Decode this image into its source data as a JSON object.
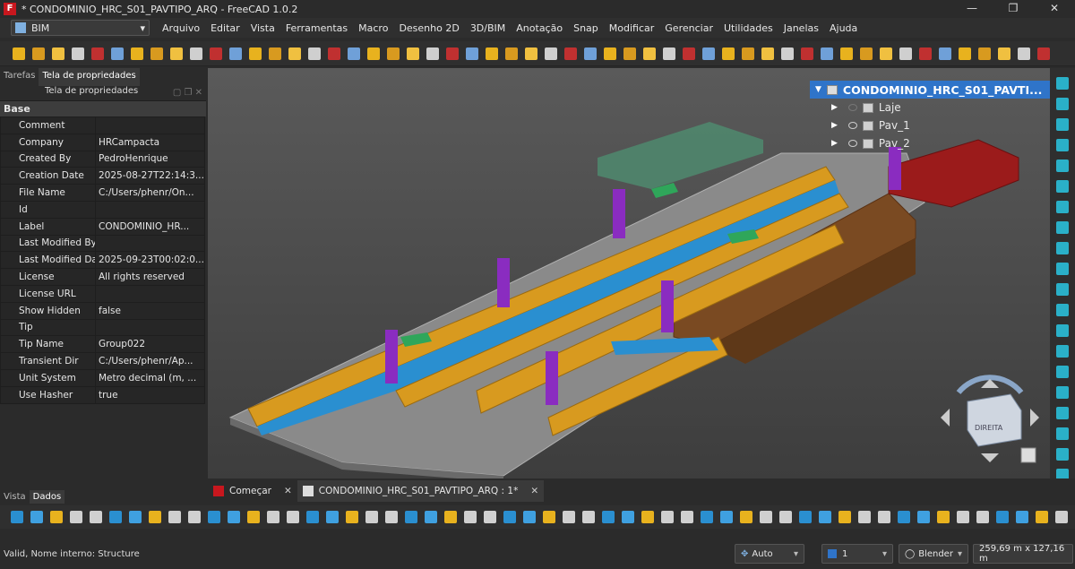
{
  "window": {
    "title": "* CONDOMINIO_HRC_S01_PAVTIPO_ARQ - FreeCAD 1.0.2",
    "logo": "F",
    "controls": [
      "—",
      "❐",
      "✕"
    ]
  },
  "workbench": {
    "selected": "BIM"
  },
  "menu": [
    "Arquivo",
    "Editar",
    "Vista",
    "Ferramentas",
    "Macro",
    "Desenho 2D",
    "3D/BIM",
    "Anotação",
    "Snap",
    "Modificar",
    "Gerenciar",
    "Utilidades",
    "Janelas",
    "Ajuda"
  ],
  "left_panel": {
    "tabs": [
      "Tarefas",
      "Tela de propriedades"
    ],
    "panel_title": "Tela de propriedades",
    "group": "Base",
    "properties": [
      {
        "key": "Comment",
        "value": ""
      },
      {
        "key": "Company",
        "value": "HRCampacta"
      },
      {
        "key": "Created By",
        "value": "PedroHenrique"
      },
      {
        "key": "Creation Date",
        "value": "2025-08-27T22:14:3..."
      },
      {
        "key": "File Name",
        "value": "C:/Users/phenr/On..."
      },
      {
        "key": "Id",
        "value": ""
      },
      {
        "key": "Label",
        "value": "CONDOMINIO_HR..."
      },
      {
        "key": "Last Modified By",
        "value": ""
      },
      {
        "key": "Last Modified Date",
        "value": "2025-09-23T00:02:0..."
      },
      {
        "key": "License",
        "value": "All rights reserved"
      },
      {
        "key": "License URL",
        "value": ""
      },
      {
        "key": "Show Hidden",
        "value": "false"
      },
      {
        "key": "Tip",
        "value": ""
      },
      {
        "key": "Tip Name",
        "value": "Group022"
      },
      {
        "key": "Transient Dir",
        "value": "C:/Users/phenr/Ap..."
      },
      {
        "key": "Unit System",
        "value": "Metro decimal (m, ..."
      },
      {
        "key": "Use Hasher",
        "value": "true"
      }
    ],
    "bottom_tabs": [
      "Vista",
      "Dados"
    ]
  },
  "tree": {
    "root": "CONDOMINIO_HRC_S01_PAVTI...",
    "children": [
      "Laje",
      "Pav_1",
      "Pav_2"
    ]
  },
  "navcube": {
    "face": "DIREITA"
  },
  "doc_tabs": [
    {
      "label": "Começar"
    },
    {
      "label": "CONDOMINIO_HRC_S01_PAVTIPO_ARQ : 1*"
    }
  ],
  "status": {
    "message": "Valid, Nome interno: Structure",
    "snap": "Auto",
    "layer": "1",
    "nav_style": "Blender",
    "dimensions": "259,69 m x 127,16 m"
  },
  "colors": {
    "orange": "#d89a1f",
    "blue": "#2a8fd0",
    "purple": "#8a2cc0",
    "brown": "#7a4a22",
    "red": "#9b1b1b",
    "green": "#2fa65a",
    "teal": "#4f8a6e",
    "selection": "#2f74c9"
  }
}
